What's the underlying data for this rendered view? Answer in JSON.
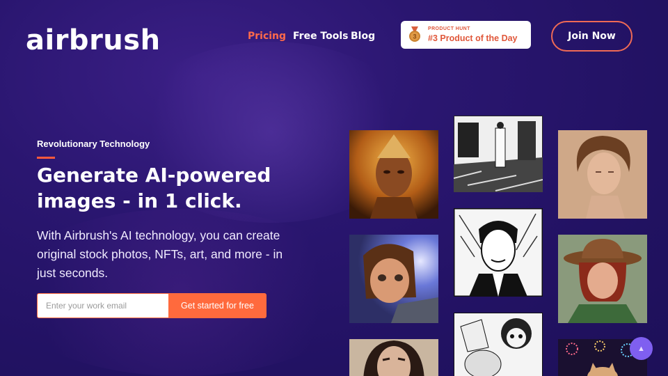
{
  "brand": {
    "logo_text": "airbrush"
  },
  "nav": {
    "items": [
      {
        "label": "Pricing",
        "active": true
      },
      {
        "label": "Free Tools",
        "active": false
      },
      {
        "label": "Blog",
        "active": false
      }
    ]
  },
  "product_hunt": {
    "eyebrow": "PRODUCT HUNT",
    "rank_text": "#3 Product of the Day",
    "medal_number": "3",
    "color": "#e0573a"
  },
  "header": {
    "join_label": "Join Now"
  },
  "hero": {
    "eyebrow": "Revolutionary Technology",
    "headline": "Generate AI-powered images - in 1 click.",
    "subtext": "With Airbrush's AI technology, you can create original stock photos, NFTs, art, and more - in just seconds."
  },
  "signup": {
    "email_placeholder": "Enter your work email",
    "email_value": "",
    "cta_label": "Get started for free"
  },
  "gallery": {
    "images": [
      {
        "name": "golden-warrior-portrait"
      },
      {
        "name": "sketched-interior-woman"
      },
      {
        "name": "curly-haired-woman-portrait"
      },
      {
        "name": "animated-girl-portrait"
      },
      {
        "name": "comic-man-in-suit"
      },
      {
        "name": "woman-in-brown-hat"
      },
      {
        "name": "woman-with-dark-hair"
      },
      {
        "name": "manga-characters-sketch"
      },
      {
        "name": "cat-with-fireworks"
      }
    ]
  },
  "scroll_top": {
    "icon": "chevron-up-icon"
  },
  "colors": {
    "accent": "#ff6a3d",
    "background": "#241366",
    "active_nav": "#ff6a4a",
    "scroll_button": "#7f5ff0"
  }
}
